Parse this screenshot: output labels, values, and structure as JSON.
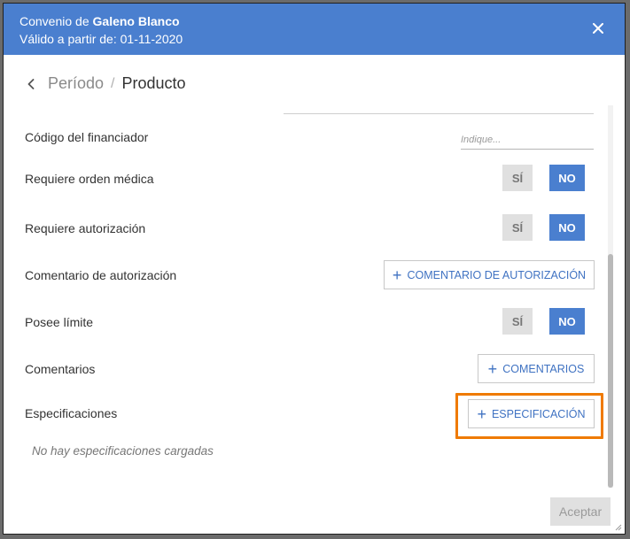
{
  "header": {
    "title_prefix": "Convenio de",
    "title_name": "Galeno Blanco",
    "subtitle": "Válido a partir de: 01-11-2020",
    "color": "#4a7fcf"
  },
  "breadcrumb": {
    "previous": "Período",
    "separator": "/",
    "current": "Producto"
  },
  "fields": {
    "codigo": {
      "label": "Código del financiador",
      "placeholder": "Indique..."
    },
    "orden_medica": {
      "label": "Requiere orden médica",
      "yes": "SÍ",
      "no": "NO",
      "selected": "NO"
    },
    "autorizacion": {
      "label": "Requiere autorización",
      "yes": "SÍ",
      "no": "NO",
      "selected": "NO"
    },
    "comentario_autorizacion": {
      "label": "Comentario de autorización",
      "button": "COMENTARIO DE AUTORIZACIÓN"
    },
    "limite": {
      "label": "Posee límite",
      "yes": "SÍ",
      "no": "NO",
      "selected": "NO"
    },
    "comentarios": {
      "label": "Comentarios",
      "button": "COMENTARIOS"
    },
    "especificaciones": {
      "label": "Especificaciones",
      "button": "ESPECIFICACIÓN",
      "empty_message": "No hay especificaciones cargadas"
    }
  },
  "icons": {
    "close": "close-icon",
    "back": "chevron-left-icon",
    "plus": "plus-icon"
  },
  "footer": {
    "accept": "Aceptar"
  },
  "colors": {
    "accent": "#4a7fcf",
    "highlight": "#ef7a00",
    "disabled_bg": "#e0e0e0"
  }
}
